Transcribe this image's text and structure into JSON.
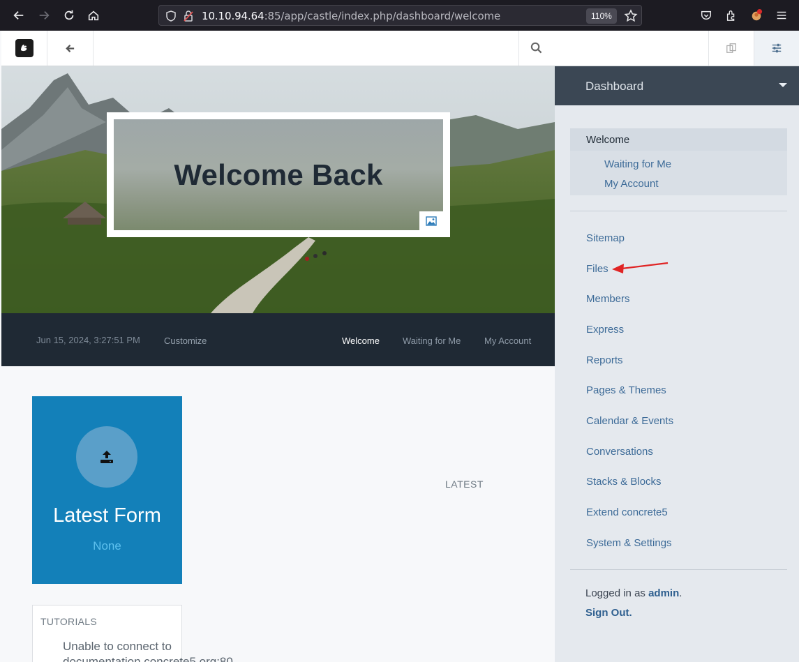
{
  "browser": {
    "url_host": "10.10.94.64",
    "url_rest": ":85/app/castle/index.php/dashboard/welcome",
    "zoom": "110%"
  },
  "hero": {
    "title": "Welcome Back"
  },
  "nav": {
    "date": "Jun 15, 2024, 3:27:51 PM",
    "customize": "Customize",
    "links": [
      "Welcome",
      "Waiting for Me",
      "My Account"
    ]
  },
  "content": {
    "form_card_title": "Latest Form",
    "form_card_value": "None",
    "latest_label": "LATEST",
    "tutorials_title": "TUTORIALS",
    "tutorials_message": "Unable to connect to documentation.concrete5.org:80"
  },
  "panel": {
    "title": "Dashboard",
    "group_head": "Welcome",
    "group_items": [
      "Waiting for Me",
      "My Account"
    ],
    "links": [
      "Sitemap",
      "Files",
      "Members",
      "Express",
      "Reports",
      "Pages & Themes",
      "Calendar & Events",
      "Conversations",
      "Stacks & Blocks",
      "Extend concrete5",
      "System & Settings"
    ],
    "logged_prefix": "Logged in as ",
    "logged_user": "admin",
    "logged_suffix": ".",
    "sign_out": "Sign Out."
  },
  "colors": {
    "accent_blue": "#1380b9",
    "panel_link": "#3d6b98",
    "annotation_arrow": "#e02424"
  }
}
